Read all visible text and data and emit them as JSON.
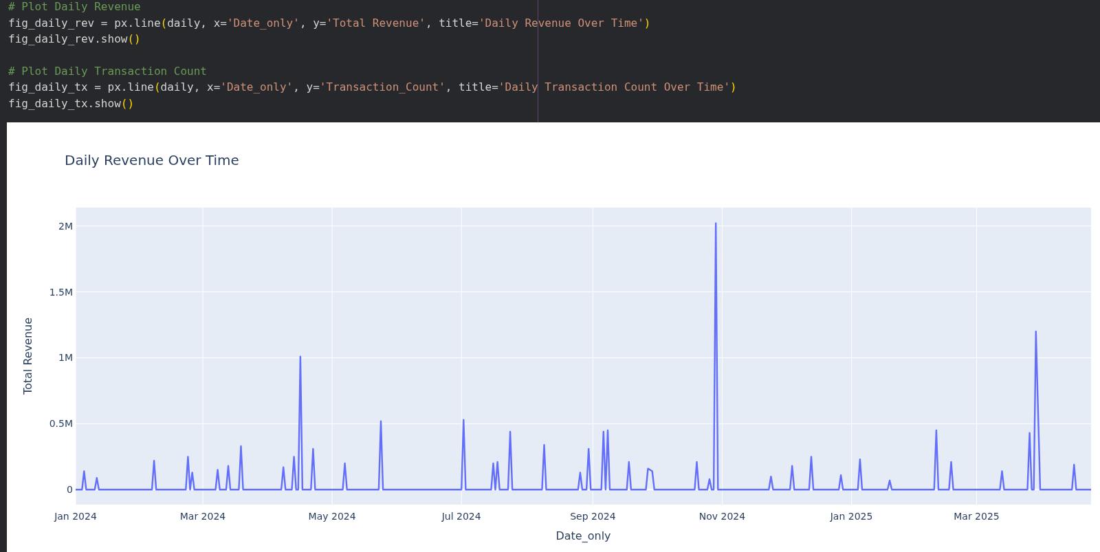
{
  "code_cell": {
    "blocks": [
      {
        "lines": [
          [
            {
              "kind": "comment",
              "text": "# Plot Daily Revenue"
            }
          ],
          [
            {
              "kind": "plain",
              "text": "fig_daily_rev = px.line"
            },
            {
              "kind": "bracket",
              "text": "("
            },
            {
              "kind": "plain",
              "text": "daily, x="
            },
            {
              "kind": "string",
              "text": "'Date_only'"
            },
            {
              "kind": "plain",
              "text": ", y="
            },
            {
              "kind": "string",
              "text": "'Total Revenue'"
            },
            {
              "kind": "plain",
              "text": ", title="
            },
            {
              "kind": "string",
              "text": "'Daily Revenue Over Time'"
            },
            {
              "kind": "bracket",
              "text": ")"
            }
          ],
          [
            {
              "kind": "plain",
              "text": "fig_daily_rev.show"
            },
            {
              "kind": "bracket",
              "text": "()"
            }
          ]
        ]
      },
      {
        "lines": [
          [
            {
              "kind": "comment",
              "text": "# Plot Daily Transaction Count"
            }
          ],
          [
            {
              "kind": "plain",
              "text": "fig_daily_tx = px.line"
            },
            {
              "kind": "bracket",
              "text": "("
            },
            {
              "kind": "plain",
              "text": "daily, x="
            },
            {
              "kind": "string",
              "text": "'Date_only'"
            },
            {
              "kind": "plain",
              "text": ", y="
            },
            {
              "kind": "string",
              "text": "'Transaction_Count'"
            },
            {
              "kind": "plain",
              "text": ", title="
            },
            {
              "kind": "string",
              "text": "'Daily Transaction Count Over Time'"
            },
            {
              "kind": "bracket",
              "text": ")"
            }
          ],
          [
            {
              "kind": "plain",
              "text": "fig_daily_tx.show"
            },
            {
              "kind": "bracket",
              "text": "()"
            }
          ]
        ]
      }
    ]
  },
  "output": {
    "chart_data": {
      "type": "line",
      "title": "Daily Revenue Over Time",
      "xlabel": "Date_only",
      "ylabel": "Total Revenue",
      "x": [
        "2024-01-01",
        "2024-01-04",
        "2024-01-05",
        "2024-01-06",
        "2024-01-10",
        "2024-01-11",
        "2024-01-12",
        "2024-02-06",
        "2024-02-07",
        "2024-02-08",
        "2024-02-22",
        "2024-02-23",
        "2024-02-24",
        "2024-02-25",
        "2024-02-26",
        "2024-03-07",
        "2024-03-08",
        "2024-03-09",
        "2024-03-12",
        "2024-03-13",
        "2024-03-14",
        "2024-03-18",
        "2024-03-19",
        "2024-03-20",
        "2024-04-07",
        "2024-04-08",
        "2024-04-09",
        "2024-04-12",
        "2024-04-13",
        "2024-04-14",
        "2024-04-15",
        "2024-04-16",
        "2024-04-17",
        "2024-04-21",
        "2024-04-22",
        "2024-04-23",
        "2024-05-06",
        "2024-05-07",
        "2024-05-08",
        "2024-05-23",
        "2024-05-24",
        "2024-05-25",
        "2024-07-01",
        "2024-07-02",
        "2024-07-03",
        "2024-07-15",
        "2024-07-16",
        "2024-07-17",
        "2024-07-18",
        "2024-07-19",
        "2024-07-23",
        "2024-07-24",
        "2024-07-25",
        "2024-08-08",
        "2024-08-09",
        "2024-08-10",
        "2024-08-25",
        "2024-08-26",
        "2024-08-27",
        "2024-08-29",
        "2024-08-30",
        "2024-08-31",
        "2024-09-05",
        "2024-09-06",
        "2024-09-07",
        "2024-09-08",
        "2024-09-09",
        "2024-09-17",
        "2024-09-18",
        "2024-09-19",
        "2024-09-26",
        "2024-09-27",
        "2024-09-29",
        "2024-09-30",
        "2024-10-19",
        "2024-10-20",
        "2024-10-21",
        "2024-10-25",
        "2024-10-26",
        "2024-10-27",
        "2024-10-28",
        "2024-10-29",
        "2024-10-30",
        "2024-11-23",
        "2024-11-24",
        "2024-11-25",
        "2024-12-03",
        "2024-12-04",
        "2024-12-05",
        "2024-12-12",
        "2024-12-13",
        "2024-12-14",
        "2024-12-26",
        "2024-12-27",
        "2024-12-28",
        "2025-01-04",
        "2025-01-05",
        "2025-01-06",
        "2025-01-18",
        "2025-01-19",
        "2025-01-20",
        "2025-02-09",
        "2025-02-10",
        "2025-02-11",
        "2025-02-16",
        "2025-02-17",
        "2025-02-18",
        "2025-03-12",
        "2025-03-13",
        "2025-03-14",
        "2025-03-25",
        "2025-03-26",
        "2025-03-27",
        "2025-03-28",
        "2025-03-29",
        "2025-03-31",
        "2025-04-15",
        "2025-04-16",
        "2025-04-17",
        "2025-04-24"
      ],
      "grid": true,
      "series": [
        {
          "color": "#636efa",
          "values": [
            0,
            0,
            140000,
            0,
            0,
            90000,
            0,
            0,
            220000,
            0,
            0,
            250000,
            0,
            130000,
            0,
            0,
            150000,
            0,
            0,
            180000,
            0,
            0,
            330000,
            0,
            0,
            170000,
            0,
            0,
            250000,
            0,
            0,
            1010000,
            0,
            0,
            310000,
            0,
            0,
            200000,
            0,
            0,
            520000,
            0,
            0,
            530000,
            0,
            0,
            200000,
            0,
            210000,
            0,
            0,
            440000,
            0,
            0,
            340000,
            0,
            0,
            130000,
            0,
            0,
            310000,
            0,
            0,
            440000,
            0,
            450000,
            0,
            0,
            210000,
            0,
            0,
            160000,
            140000,
            0,
            0,
            210000,
            0,
            0,
            80000,
            0,
            0,
            2020000,
            0,
            0,
            100000,
            0,
            0,
            180000,
            0,
            0,
            250000,
            0,
            0,
            110000,
            0,
            0,
            230000,
            0,
            0,
            70000,
            0,
            0,
            450000,
            0,
            0,
            210000,
            0,
            0,
            140000,
            0,
            0,
            430000,
            0,
            0,
            1200000,
            0,
            0,
            190000,
            0,
            0
          ]
        }
      ],
      "xlim": [
        "2024-01-01",
        "2025-04-24"
      ],
      "ylim": [
        -113000,
        2139000
      ],
      "xticks": [
        {
          "value": "2024-01-01",
          "label": "Jan 2024"
        },
        {
          "value": "2024-03-01",
          "label": "Mar 2024"
        },
        {
          "value": "2024-05-01",
          "label": "May 2024"
        },
        {
          "value": "2024-07-01",
          "label": "Jul 2024"
        },
        {
          "value": "2024-09-01",
          "label": "Sep 2024"
        },
        {
          "value": "2024-11-01",
          "label": "Nov 2024"
        },
        {
          "value": "2025-01-01",
          "label": "Jan 2025"
        },
        {
          "value": "2025-03-01",
          "label": "Mar 2025"
        }
      ],
      "yticks": [
        {
          "value": 0,
          "label": "0"
        },
        {
          "value": 500000,
          "label": "0.5M"
        },
        {
          "value": 1000000,
          "label": "1M"
        },
        {
          "value": 1500000,
          "label": "1.5M"
        },
        {
          "value": 2000000,
          "label": "2M"
        }
      ]
    }
  }
}
